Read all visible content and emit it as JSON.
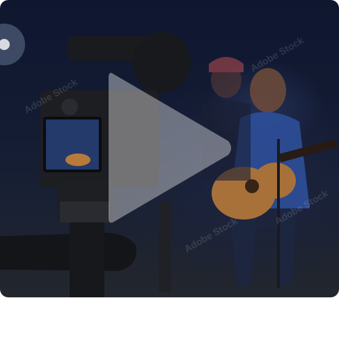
{
  "video": {
    "watermark": "Adobe Stock"
  },
  "controls": {
    "play_icon": "play-icon"
  },
  "colors": {
    "play_fill": "#ffffff",
    "background_dark": "#0f1730"
  }
}
